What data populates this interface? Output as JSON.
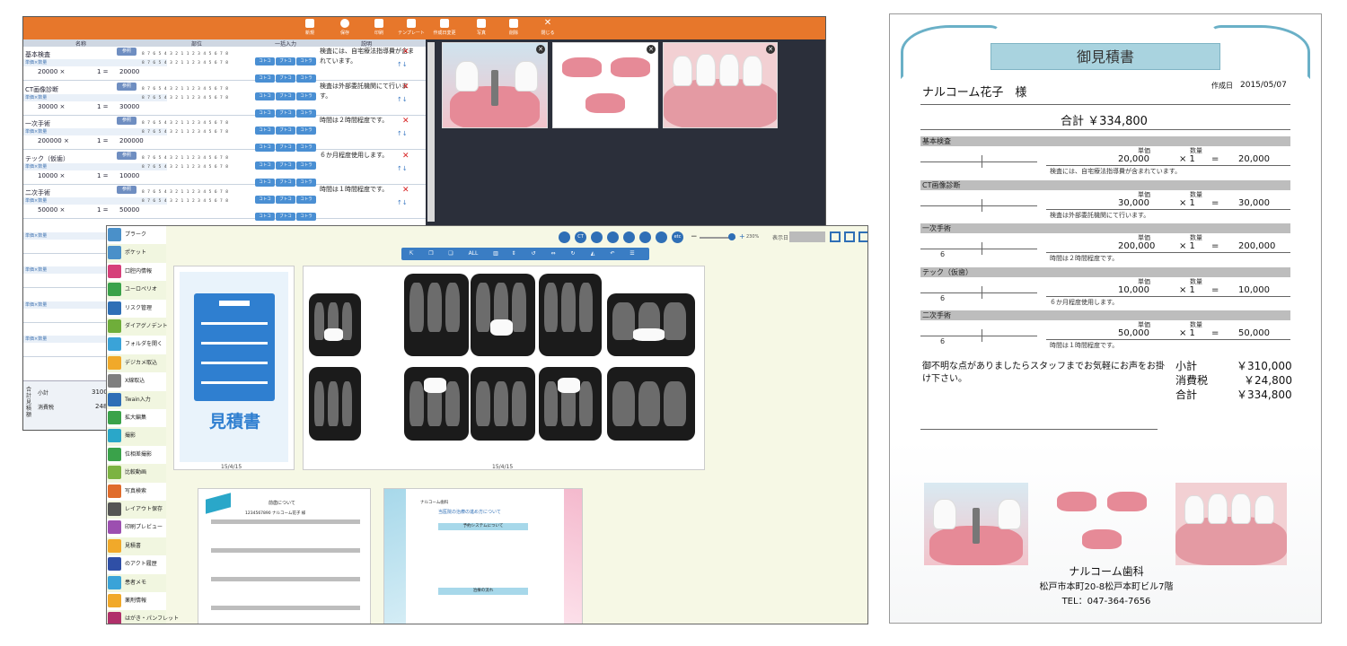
{
  "editor": {
    "toolbar": [
      {
        "label": "新規",
        "icon": "document-icon"
      },
      {
        "label": "保存",
        "icon": "check-icon"
      },
      {
        "label": "印刷",
        "icon": "printer-icon"
      },
      {
        "label": "テンプレート",
        "icon": "template-icon"
      },
      {
        "label": "作成日変更",
        "icon": "edit-icon"
      },
      {
        "label": "写真",
        "icon": "photo-icon"
      },
      {
        "label": "削除",
        "icon": "trash-icon"
      },
      {
        "label": "閉じる",
        "icon": "close-icon"
      }
    ],
    "columns": {
      "name": "名称",
      "area": "部位",
      "bulk": "一括入力",
      "desc": "説明"
    },
    "ref_label": "参照",
    "sub_label": "単価×数量",
    "teeth_row": "8 7 6 5 4 3 2 1 1 2 3 4 5 6 7 8",
    "bulk_labels": [
      "コトコ",
      "ブトコ",
      "コトラ"
    ],
    "rows": [
      {
        "name": "基本検査",
        "price": "20000 ×",
        "qty": "1 =",
        "total": "20000",
        "desc": "検査には、自宅療法指導費が含まれています。"
      },
      {
        "name": "CT画像診断",
        "price": "30000 ×",
        "qty": "1 =",
        "total": "30000",
        "desc": "検査は外部委託機関にて行います。"
      },
      {
        "name": "一次手術",
        "price": "200000 ×",
        "qty": "1 =",
        "total": "200000",
        "desc": "時間は２時間程度です。"
      },
      {
        "name": "テック（仮歯）",
        "price": "10000 ×",
        "qty": "1 =",
        "total": "10000",
        "desc": "６か月程度使用します。"
      },
      {
        "name": "二次手術",
        "price": "50000 ×",
        "qty": "1 =",
        "total": "50000",
        "desc": "時間は１時間程度です。"
      }
    ],
    "summary": {
      "vertical_label": "合計見積額",
      "subtotal_label": "小計",
      "subtotal_value": "3100",
      "tax_label": "消費税",
      "tax_value": "248"
    }
  },
  "layout_app": {
    "sidebar": [
      {
        "label": "プラーク",
        "color": "#4a90c9"
      },
      {
        "label": "ポケット",
        "color": "#4a90c9"
      },
      {
        "label": "口腔内情報",
        "color": "#d6407a"
      },
      {
        "label": "ユーロペリオ",
        "color": "#3aa24a"
      },
      {
        "label": "リスク管理",
        "color": "#2f6fb6"
      },
      {
        "label": "ダイアグノデント",
        "color": "#6fae3a"
      },
      {
        "label": "フォルダを開く",
        "color": "#3aa3d8"
      },
      {
        "label": "デジカメ取込",
        "color": "#f1a92a"
      },
      {
        "label": "X線取込",
        "color": "#7f7f7f"
      },
      {
        "label": "Twain入力",
        "color": "#2f6fb6"
      },
      {
        "label": "拡大編集",
        "color": "#3aa24a"
      },
      {
        "label": "撮影",
        "color": "#2aa7c9"
      },
      {
        "label": "位相差撮影",
        "color": "#3aa24a"
      },
      {
        "label": "比較動画",
        "color": "#7cb342"
      },
      {
        "label": "写真検索",
        "color": "#e06c2c"
      },
      {
        "label": "レイアウト保存",
        "color": "#555555"
      },
      {
        "label": "印刷プレビュー",
        "color": "#9c4fb0"
      },
      {
        "label": "見積書",
        "color": "#f1a92a"
      },
      {
        "label": "のアクト履歴",
        "color": "#2f4fa6"
      },
      {
        "label": "患者メモ",
        "color": "#3aa3d8"
      },
      {
        "label": "薬剤情報",
        "color": "#f1a92a"
      },
      {
        "label": "はがき・パンフレット",
        "color": "#b0306a"
      }
    ],
    "top_buttons": [
      "CT",
      "etc"
    ],
    "zoom": "230%",
    "display_date_label": "表示日",
    "tool_all": "ALL",
    "estimate_card_title": "見積書",
    "date_a": "15/4/15",
    "date_b": "15/4/15",
    "doc_c_title": "前歯について",
    "doc_c_patient": "1234567890 ナルコーム花子 様",
    "doc_d_header": "ナルコーム歯科",
    "doc_d_title": "当医院の治療の進め方について",
    "doc_d_section1": "予約システムについて",
    "doc_d_section2": "治療の流れ"
  },
  "doc": {
    "title": "御見積書",
    "patient": "ナルコーム花子　様",
    "date_label": "作成日",
    "date": "2015/05/07",
    "total_line": "合計 ￥334,800",
    "col_unit": "単価",
    "col_qty": "数量",
    "items": [
      {
        "name": "基本検査",
        "teeth": "",
        "price": "20,000",
        "times": "× 1",
        "eq": "=",
        "total": "20,000",
        "note": "検査には、自宅療法指導費が含まれています。"
      },
      {
        "name": "CT画像診断",
        "teeth": "",
        "price": "30,000",
        "times": "× 1",
        "eq": "=",
        "total": "30,000",
        "note": "検査は外部委託機関にて行います。"
      },
      {
        "name": "一次手術",
        "teeth": "6",
        "price": "200,000",
        "times": "× 1",
        "eq": "=",
        "total": "200,000",
        "note": "時間は２時間程度です。"
      },
      {
        "name": "テック（仮歯）",
        "teeth": "6",
        "price": "10,000",
        "times": "× 1",
        "eq": "=",
        "total": "10,000",
        "note": "６か月程度使用します。"
      },
      {
        "name": "二次手術",
        "teeth": "6",
        "price": "50,000",
        "times": "× 1",
        "eq": "=",
        "total": "50,000",
        "note": "時間は１時間程度です。"
      }
    ],
    "message": "御不明な点がありましたらスタッフまでお気軽にお声をお掛け下さい。",
    "subtotal_label": "小計",
    "subtotal": "￥310,000",
    "tax_label": "消費税",
    "tax": "￥24,800",
    "grand_label": "合計",
    "grand": "￥334,800",
    "clinic": "ナルコーム歯科",
    "address": "松戸市本町20-8松戸本町ビル7階",
    "tel": "TEL：047-364-7656"
  }
}
